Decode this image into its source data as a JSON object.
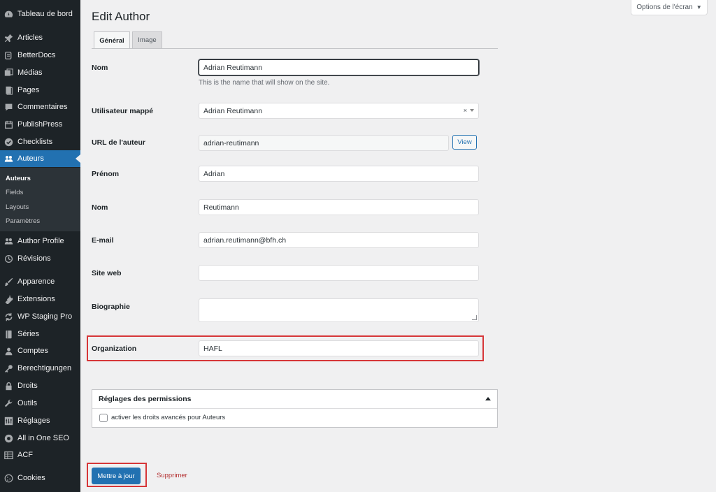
{
  "sidebar": {
    "items": [
      {
        "label": "Tableau de bord",
        "icon": "dashboard-icon"
      },
      {
        "label": "Articles",
        "icon": "pin-icon"
      },
      {
        "label": "BetterDocs",
        "icon": "docs-icon"
      },
      {
        "label": "Médias",
        "icon": "media-icon"
      },
      {
        "label": "Pages",
        "icon": "page-icon"
      },
      {
        "label": "Commentaires",
        "icon": "comment-icon"
      },
      {
        "label": "PublishPress",
        "icon": "calendar-icon"
      },
      {
        "label": "Checklists",
        "icon": "check-circle-icon"
      },
      {
        "label": "Auteurs",
        "icon": "users-icon"
      },
      {
        "label": "Author Profile",
        "icon": "users-icon"
      },
      {
        "label": "Révisions",
        "icon": "history-icon"
      },
      {
        "label": "Apparence",
        "icon": "brush-icon"
      },
      {
        "label": "Extensions",
        "icon": "plugin-icon"
      },
      {
        "label": "WP Staging Pro",
        "icon": "staging-icon"
      },
      {
        "label": "Séries",
        "icon": "book-icon"
      },
      {
        "label": "Comptes",
        "icon": "user-icon"
      },
      {
        "label": "Berechtigungen",
        "icon": "key-icon"
      },
      {
        "label": "Droits",
        "icon": "lock-icon"
      },
      {
        "label": "Outils",
        "icon": "wrench-icon"
      },
      {
        "label": "Réglages",
        "icon": "settings-icon"
      },
      {
        "label": "All in One SEO",
        "icon": "seo-icon"
      },
      {
        "label": "ACF",
        "icon": "grid-icon"
      },
      {
        "label": "Cookies",
        "icon": "cookie-icon"
      }
    ],
    "submenu": [
      "Auteurs",
      "Fields",
      "Layouts",
      "Paramètres"
    ]
  },
  "screen_options": "Options de l'écran",
  "page_title": "Edit Author",
  "tabs": [
    "Général",
    "Image"
  ],
  "form": {
    "nom_label": "Nom",
    "nom_value": "Adrian Reutimann",
    "nom_desc": "This is the name that will show on the site.",
    "mapped_user_label": "Utilisateur mappé",
    "mapped_user_value": "Adrian Reutimann",
    "clear_symbol": "×",
    "url_label": "URL de l'auteur",
    "url_value": "adrian-reutimann",
    "view_label": "View",
    "firstname_label": "Prénom",
    "firstname_value": "Adrian",
    "lastname_label": "Nom",
    "lastname_value": "Reutimann",
    "email_label": "E-mail",
    "email_value": "adrian.reutimann@bfh.ch",
    "website_label": "Site web",
    "website_value": "",
    "bio_label": "Biographie",
    "bio_value": "",
    "org_label": "Organization",
    "org_value": "HAFL"
  },
  "permissions": {
    "title": "Réglages des permissions",
    "checkbox_label": "activer les droits avancés pour Auteurs"
  },
  "actions": {
    "update_label": "Mettre à jour",
    "delete_label": "Supprimer"
  },
  "colors": {
    "accent": "#2271b1",
    "sidebar": "#1d2327",
    "highlight": "#d63638",
    "delete": "#b32d2e"
  }
}
